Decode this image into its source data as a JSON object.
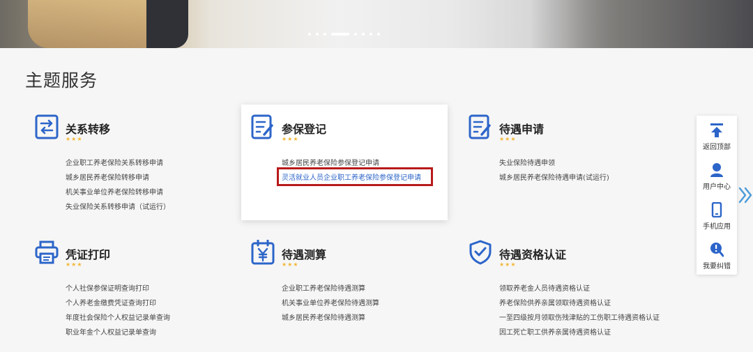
{
  "banner": {
    "carousel_dots": 8,
    "active_dot": 4
  },
  "section_title": "主题服务",
  "colors": {
    "accent_blue": "#2c65c9",
    "star_yellow": "#f2b736",
    "highlight_red": "#b81a1a"
  },
  "cards": [
    {
      "title": "关系转移",
      "icon": "transfer-icon",
      "stars": "★★★",
      "items": [
        "企业职工养老保险关系转移申请",
        "城乡居民养老保险转移申请",
        "机关事业单位养老保险转移申请",
        "失业保险关系转移申请（试运行）"
      ]
    },
    {
      "title": "参保登记",
      "icon": "register-form-icon",
      "stars": "★★★",
      "items": [
        "城乡居民养老保险参保登记申请",
        "灵活就业人员企业职工养老保险参保登记申请"
      ]
    },
    {
      "title": "待遇申请",
      "icon": "application-form-icon",
      "stars": "★★★",
      "items": [
        "失业保险待遇申领",
        "城乡居民养老保险待遇申请(试运行)"
      ]
    },
    {
      "title": "凭证打印",
      "icon": "printer-icon",
      "stars": "★★★",
      "items": [
        "个人社保参保证明查询打印",
        "个人养老金缴费凭证查询打印",
        "年度社会保险个人权益记录单查询",
        "职业年金个人权益记录单查询"
      ]
    },
    {
      "title": "待遇测算",
      "icon": "calculator-yen-icon",
      "stars": "★★★",
      "items": [
        "企业职工养老保险待遇测算",
        "机关事业单位养老保险待遇测算",
        "城乡居民养老保险待遇测算"
      ]
    },
    {
      "title": "待遇资格认证",
      "icon": "shield-check-icon",
      "stars": "★★★",
      "items": [
        "领取养老金人员待遇资格认证",
        "养老保险供养亲属领取待遇资格认证",
        "一至四级按月领取伤残津贴的工伤职工待遇资格认证",
        "因工死亡职工供养亲属待遇资格认证"
      ]
    }
  ],
  "float_bar": [
    {
      "label": "返回顶部",
      "icon": "arrow-up-top-icon"
    },
    {
      "label": "用户中心",
      "icon": "user-icon"
    },
    {
      "label": "手机应用",
      "icon": "mobile-phone-icon"
    },
    {
      "label": "我要纠错",
      "icon": "error-report-icon"
    }
  ]
}
